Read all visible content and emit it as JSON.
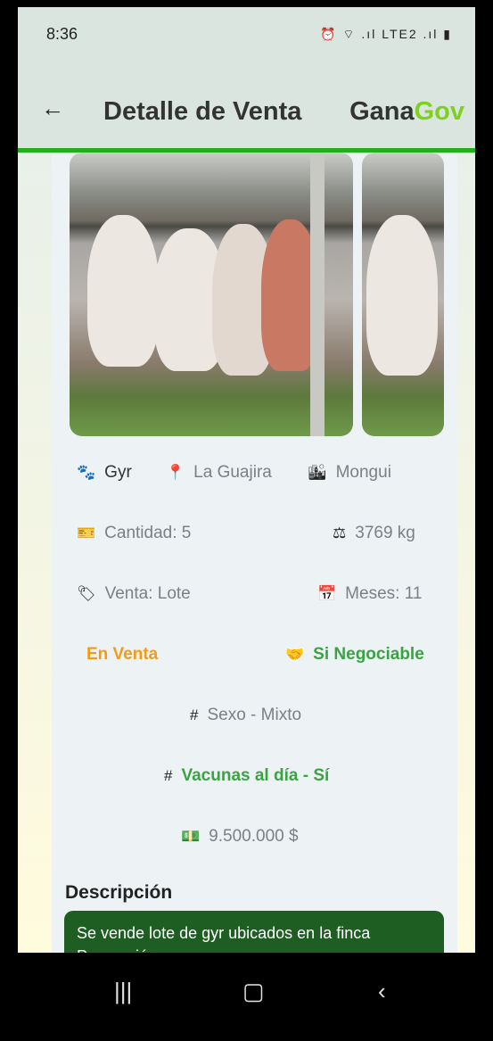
{
  "status": {
    "time": "8:36",
    "icons": "⏰ ⌔ .ıl LTE2 .ıl ▮"
  },
  "appbar": {
    "title": "Detalle de Venta",
    "brand_part1": "Gana",
    "brand_part2": "Gov"
  },
  "info": {
    "breed": "Gyr",
    "location": "La Guajira",
    "city": "Mongui",
    "quantity": "Cantidad: 5",
    "weight": "3769 kg",
    "sale_type": "Venta: Lote",
    "months": "Meses: 11",
    "status": "En Venta",
    "negotiable": "Si Negociable",
    "sex": "Sexo - Mixto",
    "vaccines": "Vacunas al día - Sí",
    "price": "9.500.000 $"
  },
  "description": {
    "title": "Descripción",
    "text": "Se vende lote de gyr ubicados en la finca Prevención"
  },
  "colors": {
    "accent_green": "#22b01a",
    "brand_green": "#7ed021",
    "status_orange": "#f39c12",
    "negotiable_green": "#3aa344",
    "desc_bg": "#1f5e22"
  }
}
